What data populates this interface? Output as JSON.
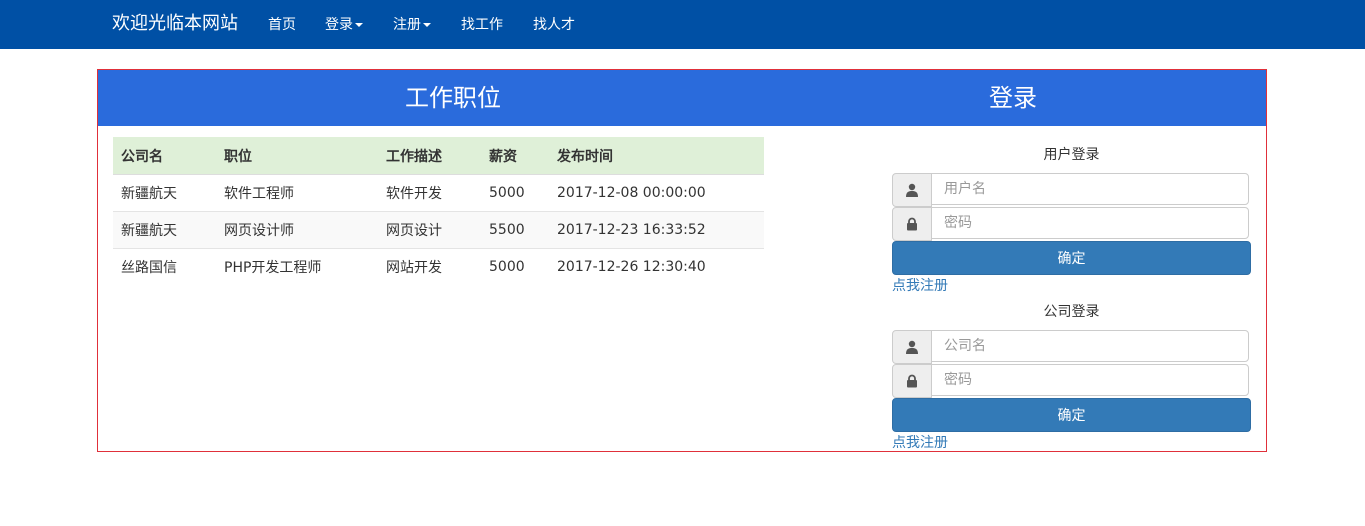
{
  "navbar": {
    "brand": "欢迎光临本网站",
    "items": [
      {
        "label": "首页",
        "dropdown": false
      },
      {
        "label": "登录",
        "dropdown": true
      },
      {
        "label": "注册",
        "dropdown": true
      },
      {
        "label": "找工作",
        "dropdown": false
      },
      {
        "label": "找人才",
        "dropdown": false
      }
    ]
  },
  "jobs_panel": {
    "title": "工作职位",
    "columns": [
      "公司名",
      "职位",
      "工作描述",
      "薪资",
      "发布时间"
    ],
    "rows": [
      [
        "新疆航天",
        "软件工程师",
        "软件开发",
        "5000",
        "2017-12-08 00:00:00"
      ],
      [
        "新疆航天",
        "网页设计师",
        "网页设计",
        "5500",
        "2017-12-23 16:33:52"
      ],
      [
        "丝路国信",
        "PHP开发工程师",
        "网站开发",
        "5000",
        "2017-12-26 12:30:40"
      ]
    ]
  },
  "login_panel": {
    "title": "登录",
    "user_login": {
      "title": "用户登录",
      "username_placeholder": "用户名",
      "password_placeholder": "密码",
      "submit_label": "确定",
      "register_link": "点我注册"
    },
    "company_login": {
      "title": "公司登录",
      "username_placeholder": "公司名",
      "password_placeholder": "密码",
      "submit_label": "确定",
      "register_link": "点我注册"
    }
  },
  "colors": {
    "navbar_bg": "#0050a5",
    "panel_header_bg": "#2a6bdc",
    "table_header_bg": "#dff0d8",
    "button_bg": "#337ab7",
    "panel_border": "#e0303a"
  },
  "icons": [
    "user-icon",
    "lock-icon",
    "caret-down-icon"
  ]
}
